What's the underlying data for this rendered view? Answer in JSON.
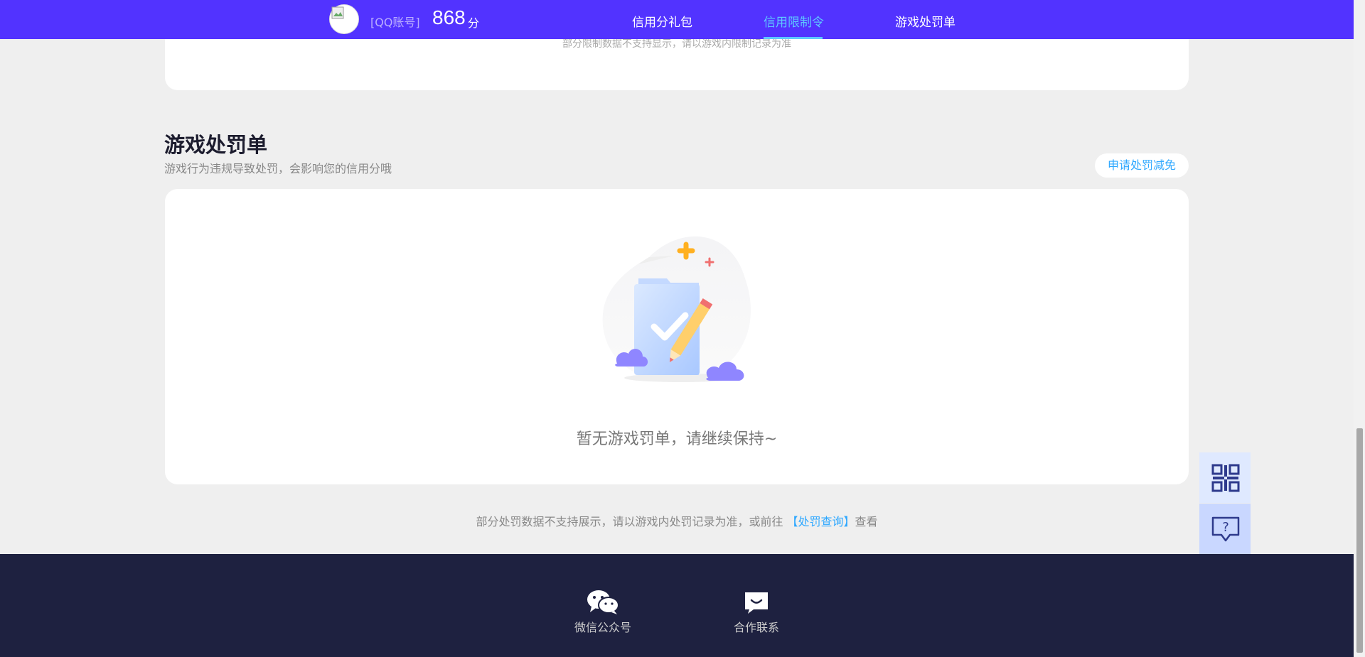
{
  "header": {
    "account_label": "[QQ账号]",
    "score": "868",
    "score_unit": "分",
    "nav": [
      {
        "label": "信用分礼包"
      },
      {
        "label": "信用限制令"
      },
      {
        "label": "游戏处罚单"
      }
    ],
    "active_nav": "信用限制令"
  },
  "restrictions": {
    "note": "部分限制数据不支持显示，请以游戏内限制记录为准"
  },
  "penalty": {
    "title": "游戏处罚单",
    "subtitle": "游戏行为违规导致处罚，会影响您的信用分哦",
    "apply_button": "申请处罚减免",
    "empty_text": "暂无游戏罚单，请继续保持~",
    "footnote_prefix": "部分处罚数据不支持展示，请以游戏内处罚记录为准，或前往 ",
    "footnote_link": "【处罚查询】",
    "footnote_suffix": "查看"
  },
  "footer": {
    "items": [
      {
        "label": "微信公众号",
        "icon": "wechat-icon"
      },
      {
        "label": "合作联系",
        "icon": "chat-icon"
      }
    ]
  },
  "colors": {
    "brand": "#5233ff",
    "accent": "#5ec8ff",
    "link": "#2fa8ff",
    "footer_bg": "#1e2140"
  }
}
